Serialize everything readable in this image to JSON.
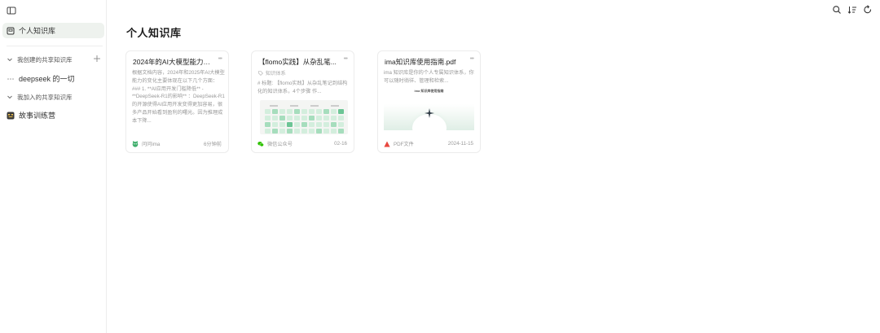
{
  "sidebar": {
    "toggle_icon": "sidebar-toggle-icon",
    "personal": {
      "label": "个人知识库",
      "icon": "knowledge-base-icon"
    },
    "created_section": {
      "label": "我创建的共享知识库",
      "icon": "chevron-down-icon"
    },
    "created_items": [
      {
        "label": "deepseek 的一切",
        "icon": "dots-icon"
      }
    ],
    "joined_section": {
      "label": "我加入的共享知识库",
      "icon": "chevron-down-icon"
    },
    "joined_items": [
      {
        "label": "故事训练营",
        "icon": "story-icon"
      }
    ]
  },
  "topbar": {
    "icons": [
      "search-icon",
      "sort-icon",
      "refresh-icon"
    ]
  },
  "main": {
    "title": "个人知识库",
    "cards": [
      {
        "title": "2024年的AI大模型能力跟...",
        "excerpt": "根据文档内容，2024年和2025年AI大模型能力的变化主要体现在以下几个方面： ### 1. **AI应用开发门槛降低** - **DeepSeek-R1的影响** ：DeepSeek-R1的开源使得AI应用开发变得更加容易，很多产品开始看到盈利的曙光。因为推理成本下降...",
        "source": "问问ima",
        "time": "6分钟前",
        "source_icon": "ima-icon"
      },
      {
        "title": "【flomo实践】从杂乱笔...",
        "tag": "知识体系",
        "excerpt": "# 标题: 【flomo实践】从杂乱笔记到结构化的知识体系，4个步骤 作...",
        "source": "微信公众号",
        "time": "02-16",
        "source_icon": "wechat-icon"
      },
      {
        "title": "ima知识库使用指南.pdf",
        "excerpt": "ima 知识库是你的个人专属知识体系，你可以随时徜徉、管理和检索...",
        "source": "PDF文件",
        "time": "2024-11-15",
        "source_icon": "pdf-icon",
        "thumb_heading": "ima 知识库使用指南"
      }
    ]
  },
  "colors": {
    "active_bg": "#eef2ee",
    "accent_green": "#6cc595",
    "pdf_red": "#e8483f",
    "wechat_green": "#2dc100"
  }
}
